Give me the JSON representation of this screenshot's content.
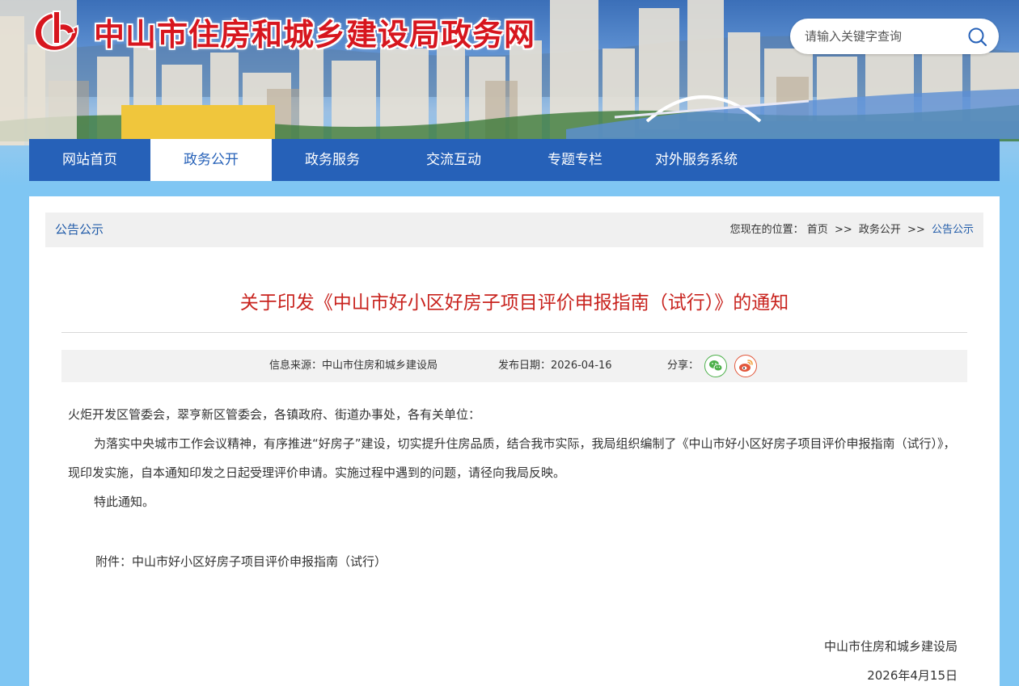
{
  "header": {
    "site_title": "中山市住房和城乡建设局政务网",
    "search_placeholder": "请输入关键字查询"
  },
  "nav": {
    "items": [
      {
        "label": "网站首页"
      },
      {
        "label": "政务公开"
      },
      {
        "label": "政务服务"
      },
      {
        "label": "交流互动"
      },
      {
        "label": "专题专栏"
      },
      {
        "label": "对外服务系统"
      }
    ],
    "active_index": 1
  },
  "breadcrumb": {
    "section_title": "公告公示",
    "prefix": "您现在的位置：",
    "separator": ">>",
    "items": [
      "首页",
      "政务公开",
      "公告公示"
    ]
  },
  "article": {
    "title": "关于印发《中山市好小区好房子项目评价申报指南（试行）》的通知",
    "source_label": "信息来源：中山市住房和城乡建设局",
    "date_label": "发布日期：2026-04-16",
    "share_label": "分享：",
    "salutation": "火炬开发区管委会，翠亨新区管委会，各镇政府、街道办事处，各有关单位：",
    "paragraph1": "为落实中央城市工作会议精神，有序推进“好房子”建设，切实提升住房品质，结合我市实际，我局组织编制了《中山市好小区好房子项目评价申报指南（试行）》，现印发实施，自本通知印发之日起受理评价申请。实施过程中遇到的问题，请径向我局反映。",
    "paragraph2": "特此通知。",
    "attachment": "附件：中山市好小区好房子项目评价申报指南（试行）",
    "signature_org": "中山市住房和城乡建设局",
    "signature_date": "2026年4月15日"
  },
  "colors": {
    "nav_bg": "#2661b8",
    "title_red": "#c8231e",
    "link_blue": "#1f5aa8",
    "page_bg": "#7fc6f3"
  },
  "icons": {
    "search": "search-icon",
    "wechat": "wechat-icon",
    "weibo": "weibo-icon"
  }
}
